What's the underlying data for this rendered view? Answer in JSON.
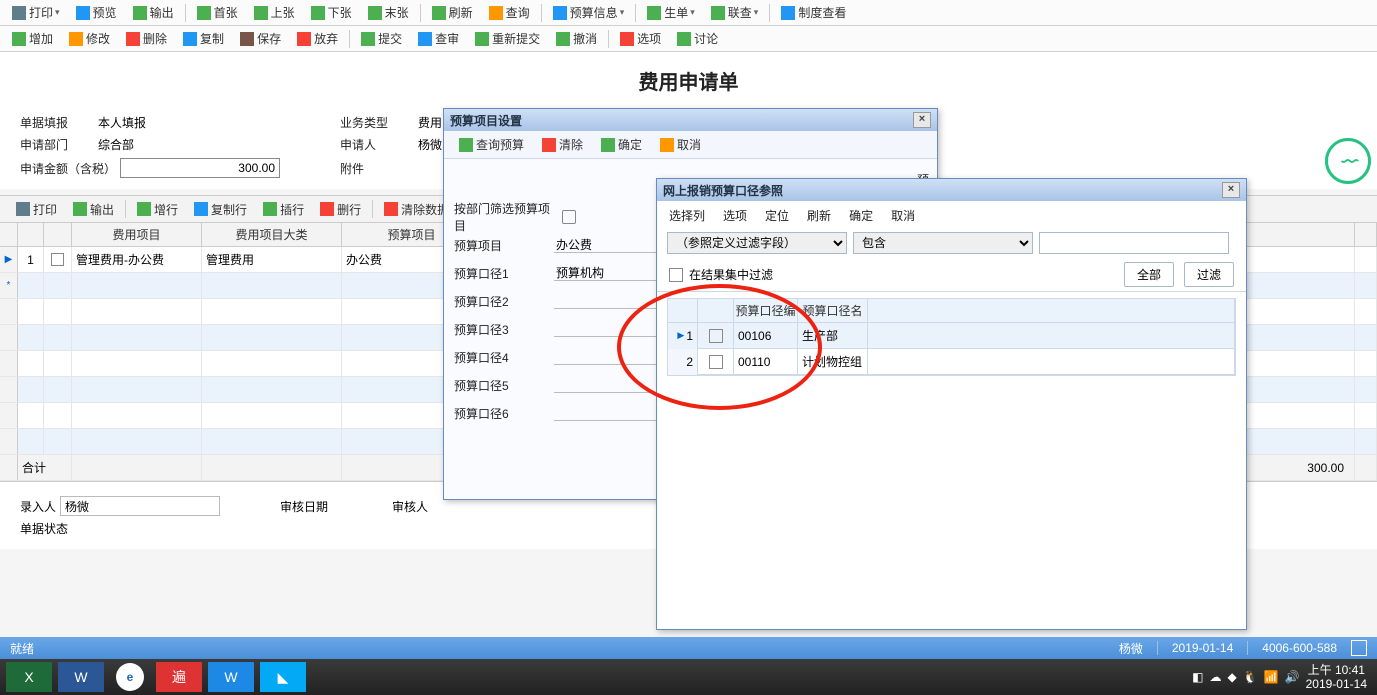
{
  "toolbars": {
    "row1": [
      "打印",
      "预览",
      "输出",
      "首张",
      "上张",
      "下张",
      "末张",
      "刷新",
      "查询",
      "预算信息",
      "生单",
      "联查",
      "制度查看"
    ],
    "row2": [
      "增加",
      "修改",
      "删除",
      "复制",
      "保存",
      "放弃",
      "提交",
      "查审",
      "重新提交",
      "撤消",
      "选项",
      "讨论"
    ]
  },
  "title": "费用申请单",
  "form": {
    "fill_mode_label": "单据填报",
    "fill_mode_value": "本人填报",
    "biz_type_label": "业务类型",
    "biz_type_value": "费用申请单",
    "dept_label": "申请部门",
    "dept_value": "综合部",
    "applicant_label": "申请人",
    "applicant_value": "杨微",
    "amount_label": "申请金额（含税）",
    "amount_value": "300.00",
    "attach_label": "附件"
  },
  "grid_toolbar": [
    "打印",
    "输出",
    "增行",
    "复制行",
    "插行",
    "删行",
    "清除数据"
  ],
  "grid": {
    "headers": [
      "",
      "费用项目",
      "费用项目大类",
      "预算项目"
    ],
    "row1": {
      "idx": "1",
      "expense_item": "管理费用-办公费",
      "expense_cat": "管理费用",
      "budget_item": "办公费"
    },
    "total_label": "合计",
    "total_amount": "300.00"
  },
  "dlg_budget": {
    "title": "预算项目设置",
    "btns": {
      "query": "查询预算",
      "clear": "清除",
      "ok": "确定",
      "cancel": "取消"
    },
    "rows": {
      "filter_by_dept": "按部门筛选预算项目",
      "budget_item": "预算项目",
      "budget_item_val": "办公费",
      "cal1": "预算口径1",
      "cal1_val": "预算机构",
      "cal2": "预算口径2",
      "cal3": "预算口径3",
      "cal4": "预算口径4",
      "cal5": "预算口径5",
      "cal6": "预算口径6"
    },
    "trunc": "预"
  },
  "dlg_ref": {
    "title": "网上报销预算口径参照",
    "menu": [
      "选择列",
      "选项",
      "定位",
      "刷新",
      "确定",
      "取消"
    ],
    "sel1_placeholder": "（参照定义过滤字段）",
    "sel2_placeholder": "包含",
    "chk_label": "在结果集中过滤",
    "btn_all": "全部",
    "btn_filter": "过滤",
    "headers": {
      "code": "预算口径编",
      "name": "预算口径名"
    },
    "rows": [
      {
        "idx": "1",
        "code": "00106",
        "name": "生产部"
      },
      {
        "idx": "2",
        "code": "00110",
        "name": "计划物控组"
      }
    ]
  },
  "bottom": {
    "entry_label": "录入人",
    "entry_val": "杨微",
    "audit_date_label": "审核日期",
    "auditor_label": "审核人",
    "doc_status_label": "单据状态"
  },
  "statusbar": {
    "left": "就绪",
    "user": "杨微",
    "date": "2019-01-14",
    "phone": "4006-600-588"
  },
  "taskbar": {
    "time": "上午 10:41",
    "date": "2019-01-14"
  }
}
